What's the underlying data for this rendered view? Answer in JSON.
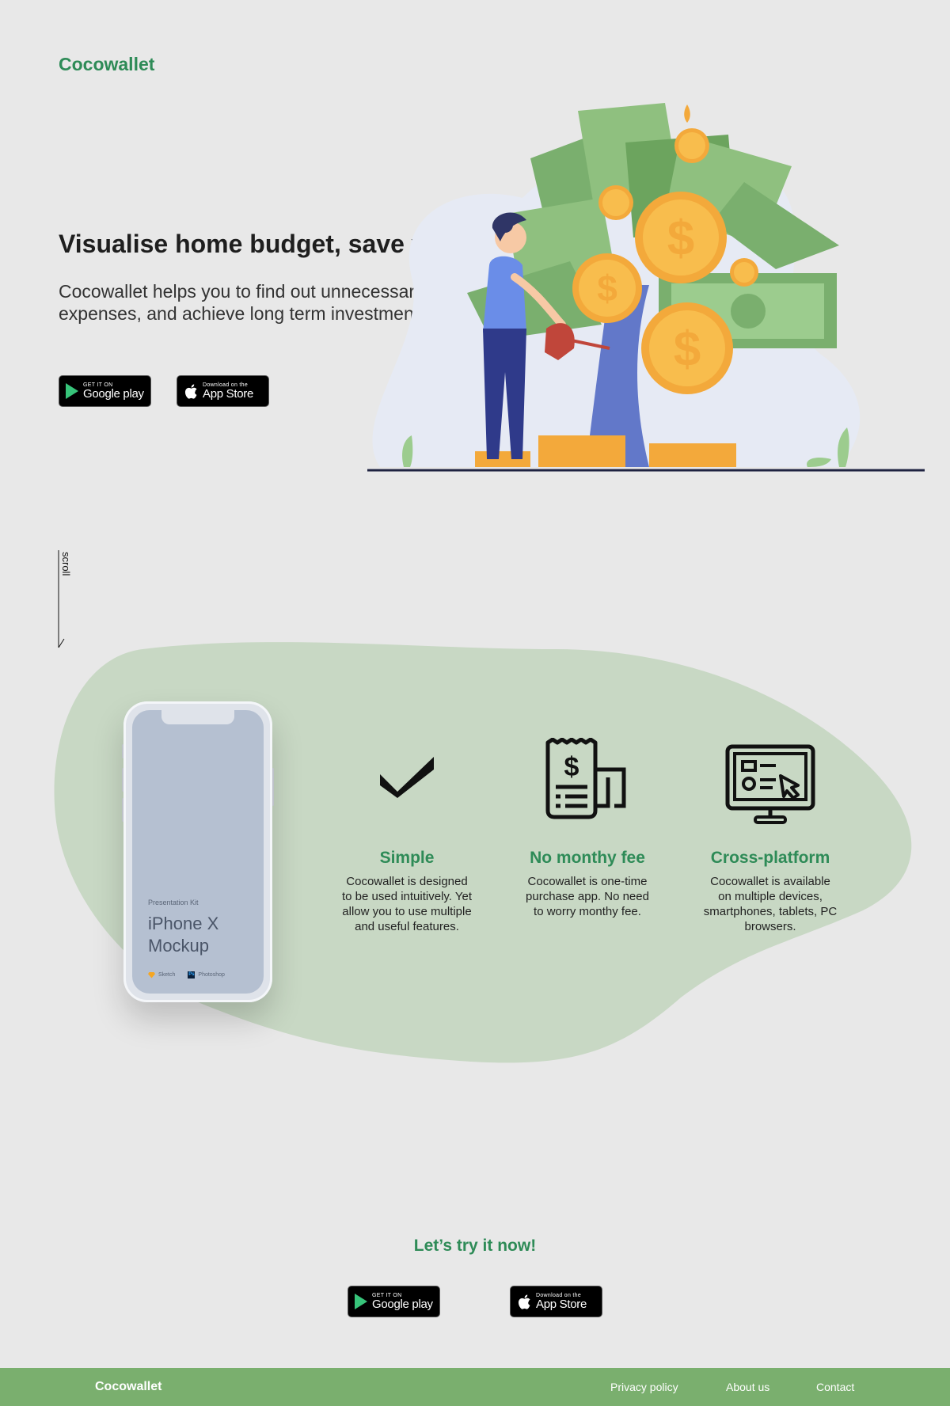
{
  "brand": {
    "name": "Cocowallet",
    "color": "#2e8b57"
  },
  "hero": {
    "title": "Visualise home budget, save wisely",
    "subtitle": "Cocowallet helps you to find out unnecessary expenses, and achieve long term investment."
  },
  "badges": {
    "google": {
      "small": "GET IT ON",
      "big": "Google play",
      "icon": "google-play-icon"
    },
    "apple": {
      "small": "Download on the",
      "big": "App Store",
      "icon": "apple-icon"
    }
  },
  "scroll_label": "scroll",
  "phone": {
    "kit_label": "Presentation Kit",
    "model": "iPhone X Mockup",
    "tools": [
      "Sketch",
      "Photoshop"
    ]
  },
  "features": [
    {
      "icon": "checkmark-icon",
      "title": "Simple",
      "description": "Cocowallet is designed to be used intuitively. Yet allow you to use multiple and useful features."
    },
    {
      "icon": "receipt-icon",
      "title": "No monthy fee",
      "description": "Cocowallet is one-time purchase app. No need to worry monthy fee."
    },
    {
      "icon": "monitor-icon",
      "title": "Cross-platform",
      "description": "Cocowallet is available on multiple devices, smartphones, tablets, PC browsers."
    }
  ],
  "cta": {
    "title": "Let’s try it now!"
  },
  "footer": {
    "brand": "Cocowallet",
    "links": [
      "Privacy policy",
      "About us",
      "Contact"
    ],
    "background": "#7aaf6e"
  }
}
